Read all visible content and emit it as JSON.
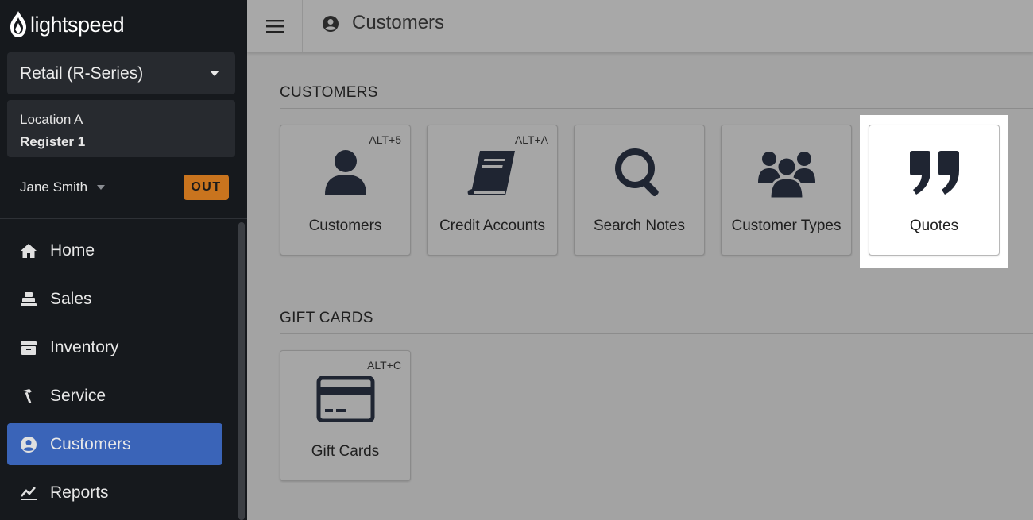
{
  "app": {
    "brand": "lightspeed"
  },
  "sidebar": {
    "product": "Retail (R-Series)",
    "location": "Location A",
    "register": "Register 1",
    "user": "Jane Smith",
    "status_badge": "OUT",
    "nav": [
      {
        "label": "Home",
        "icon": "home-icon"
      },
      {
        "label": "Sales",
        "icon": "register-icon"
      },
      {
        "label": "Inventory",
        "icon": "inventory-icon"
      },
      {
        "label": "Service",
        "icon": "hammer-icon"
      },
      {
        "label": "Customers",
        "icon": "user-circle-icon",
        "active": true
      },
      {
        "label": "Reports",
        "icon": "chart-icon"
      }
    ]
  },
  "header": {
    "title": "Customers",
    "icon": "user-circle-icon"
  },
  "sections": {
    "customers": {
      "title": "CUSTOMERS",
      "tiles": [
        {
          "label": "Customers",
          "shortcut": "ALT+5",
          "icon": "user-icon"
        },
        {
          "label": "Credit Accounts",
          "shortcut": "ALT+A",
          "icon": "book-icon"
        },
        {
          "label": "Search Notes",
          "shortcut": "",
          "icon": "search-icon"
        },
        {
          "label": "Customer Types",
          "shortcut": "",
          "icon": "users-icon"
        },
        {
          "label": "Quotes",
          "shortcut": "",
          "icon": "quote-icon",
          "highlighted": true
        }
      ]
    },
    "gift_cards": {
      "title": "GIFT CARDS",
      "tiles": [
        {
          "label": "Gift Cards",
          "shortcut": "ALT+C",
          "icon": "credit-card-icon"
        }
      ]
    }
  },
  "colors": {
    "accent": "#3a64b8",
    "badge": "#c9741e",
    "sidebar": "#16191d"
  }
}
